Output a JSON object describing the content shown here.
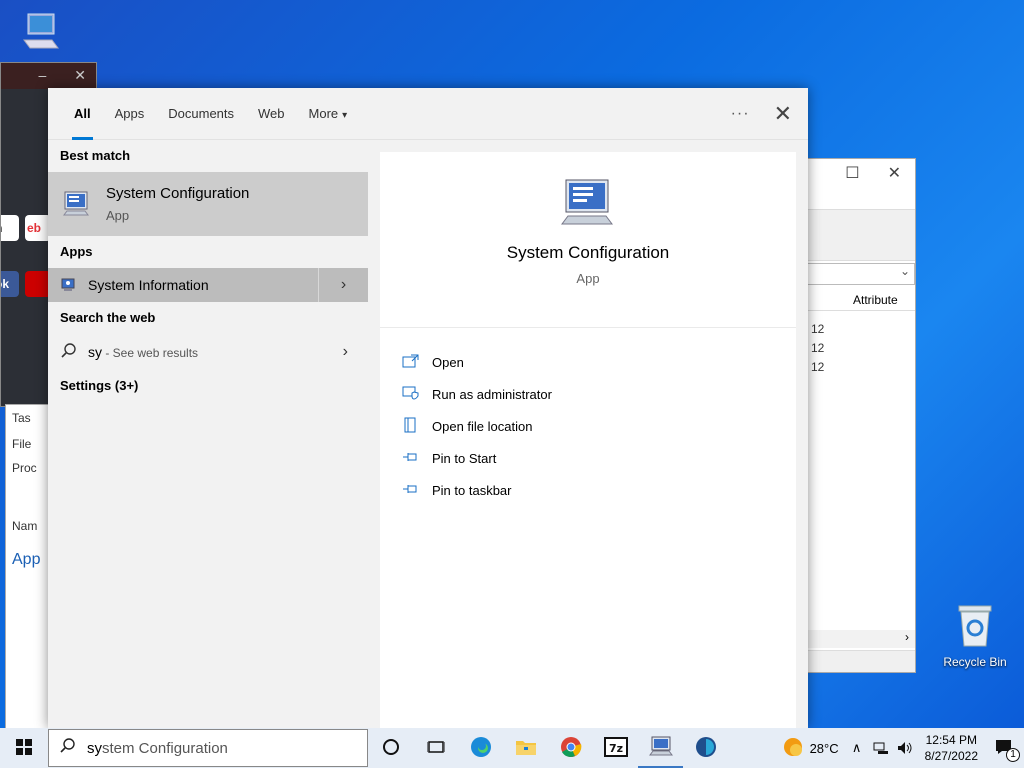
{
  "desktop": {
    "recycle_bin_label": "Recycle Bin"
  },
  "background": {
    "browser_tiles": [
      "n",
      "eb",
      "ok"
    ],
    "explorer_column": "Attribute",
    "explorer_rows": [
      "12",
      "12",
      "12"
    ],
    "taskmgr_lines": [
      "Tas",
      "File",
      "Proc",
      "Nam",
      "App"
    ]
  },
  "search_panel": {
    "tabs": [
      {
        "label": "All"
      },
      {
        "label": "Apps"
      },
      {
        "label": "Documents"
      },
      {
        "label": "Web"
      },
      {
        "label": "More"
      }
    ],
    "more_caret": "▾",
    "best_match_heading": "Best match",
    "best_match": {
      "title": "System Configuration",
      "subtitle": "App"
    },
    "apps_heading": "Apps",
    "apps": [
      {
        "label": "System Information"
      }
    ],
    "search_web_heading": "Search the web",
    "web_query": "sy",
    "web_suffix": " - See web results",
    "settings_heading": "Settings (3+)",
    "preview": {
      "title": "System Configuration",
      "subtitle": "App"
    },
    "actions": [
      {
        "label": "Open",
        "icon": "open-icon"
      },
      {
        "label": "Run as administrator",
        "icon": "shield-icon"
      },
      {
        "label": "Open file location",
        "icon": "file-location-icon"
      },
      {
        "label": "Pin to Start",
        "icon": "pin-icon"
      },
      {
        "label": "Pin to taskbar",
        "icon": "pin-icon"
      }
    ]
  },
  "taskbar": {
    "search_typed": "sy",
    "search_suggest": "stem Configuration",
    "weather": "28°C",
    "time": "12:54 PM",
    "date": "8/27/2022",
    "notifications_count": "1"
  }
}
